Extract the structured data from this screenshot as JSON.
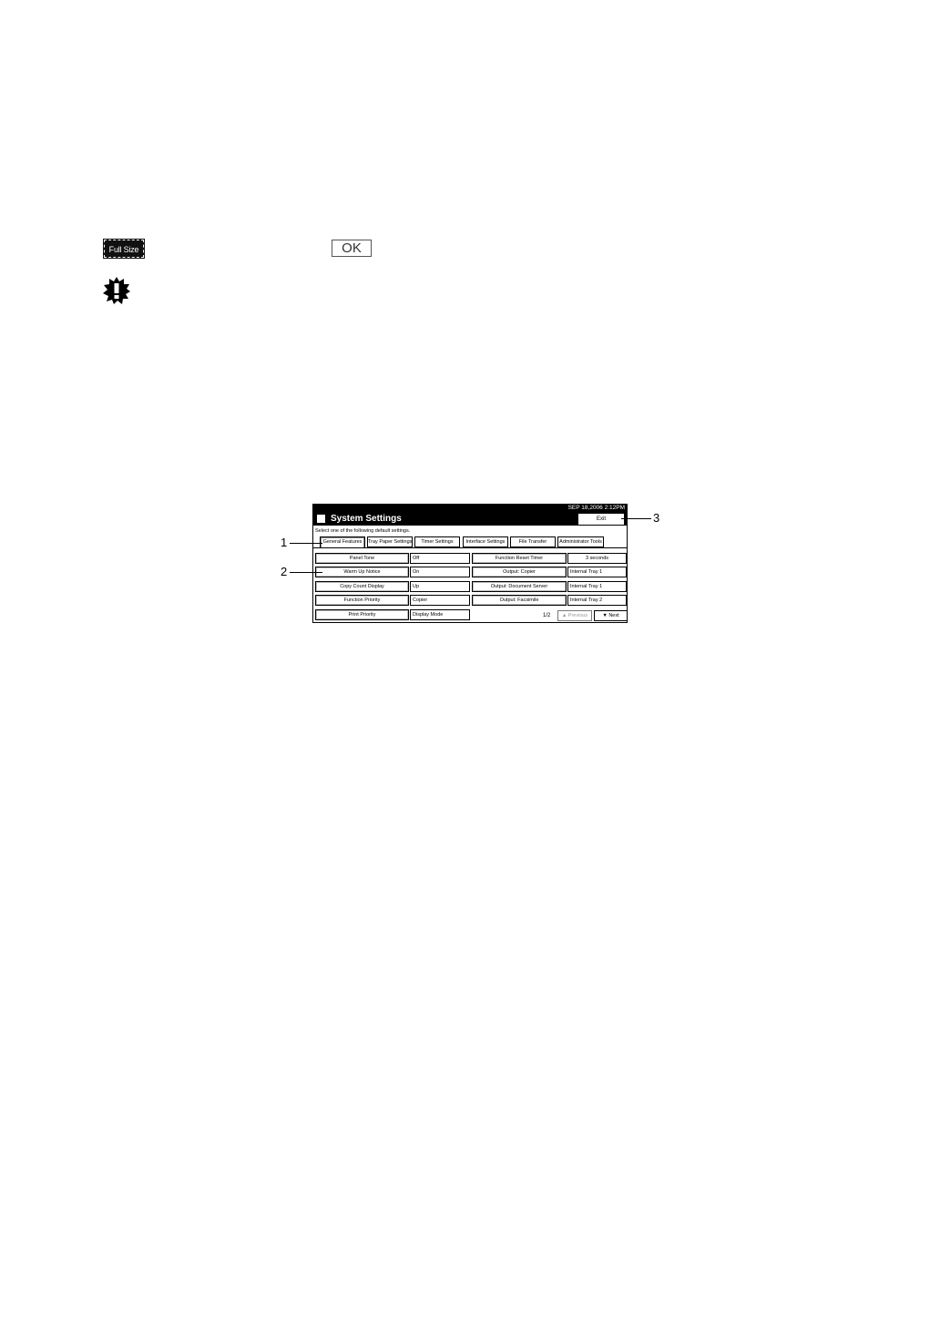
{
  "keys": {
    "full_size": "Full Size",
    "ok": "OK"
  },
  "panel": {
    "datetime": "SEP  18,2006  2:12PM",
    "title": "System Settings",
    "exit": "Exit",
    "instruction": "Select one of the following default settings.",
    "tabs": [
      {
        "label": "General Features",
        "active": true
      },
      {
        "label": "Tray Paper Settings",
        "active": false
      },
      {
        "label": "Timer Settings",
        "active": false
      },
      {
        "label": "Interface Settings",
        "active": false
      },
      {
        "label": "File Transfer",
        "active": false
      },
      {
        "label": "Administrator Tools",
        "active": false
      }
    ],
    "left_rows": [
      {
        "label": "Panel Tone",
        "value": "Off"
      },
      {
        "label": "Warm Up Notice",
        "value": "On"
      },
      {
        "label": "Copy Count Display",
        "value": "Up"
      },
      {
        "label": "Function Priority",
        "value": "Copier"
      },
      {
        "label": "Print Priority",
        "value": "Display Mode"
      }
    ],
    "right_rows": [
      {
        "label": "Function Reset Timer",
        "value": "3  seconds"
      },
      {
        "label": "Output: Copier",
        "value": "Internal Tray 1"
      },
      {
        "label": "Output: Document Server",
        "value": "Internal Tray 1"
      },
      {
        "label": "Output: Facsimile",
        "value": "Internal Tray 2"
      }
    ],
    "page": "1/2",
    "previous": "▲ Previous",
    "next": "▼ Next"
  },
  "callouts": [
    "1",
    "2",
    "3"
  ]
}
